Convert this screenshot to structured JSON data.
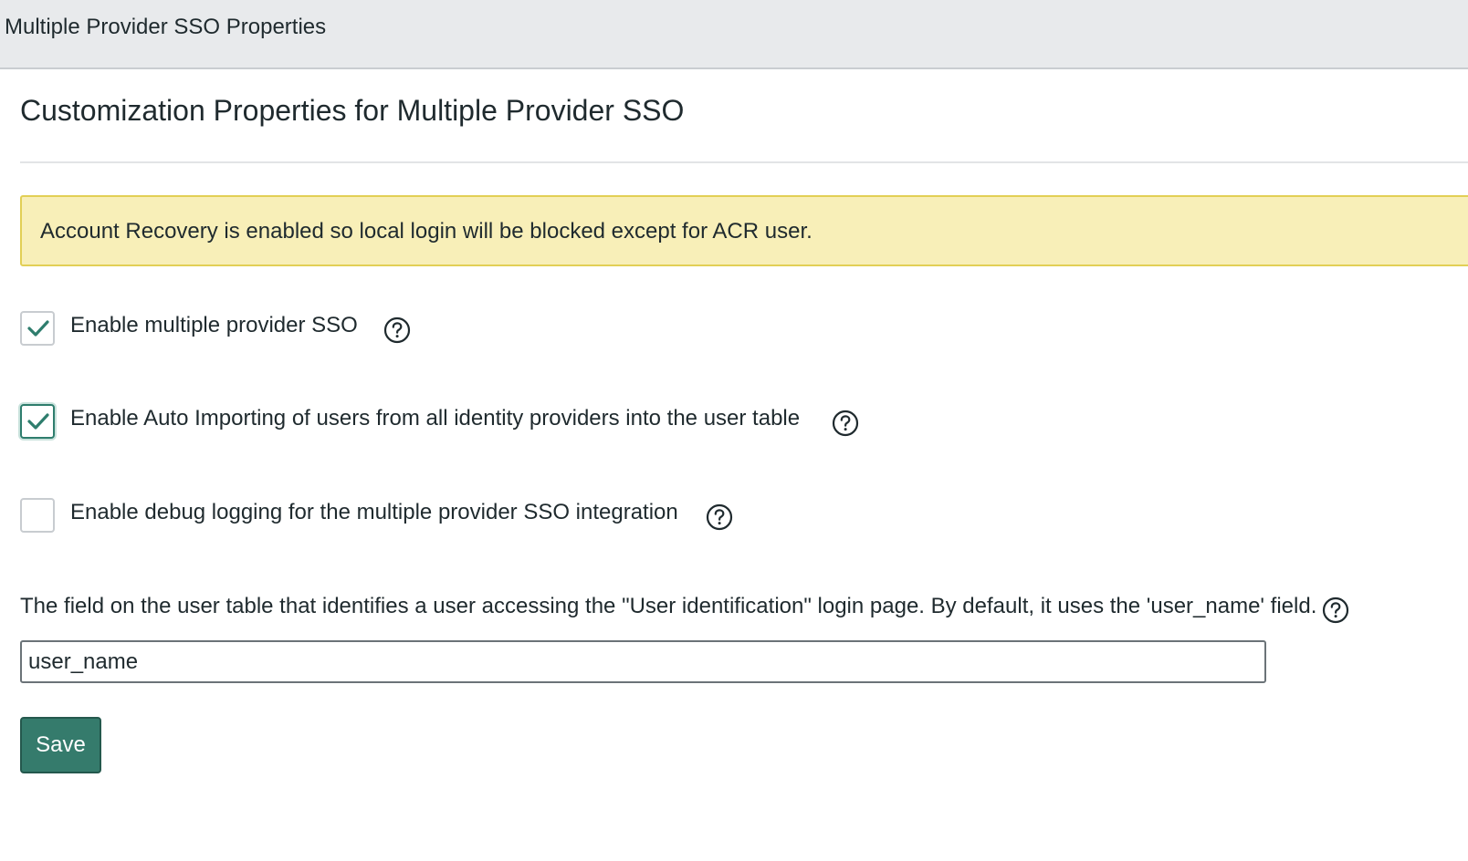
{
  "header": {
    "title": "Multiple Provider SSO Properties"
  },
  "page": {
    "title": "Customization Properties for Multiple Provider SSO"
  },
  "alert": {
    "message": "Account Recovery is enabled so local login will be blocked except for ACR user."
  },
  "options": [
    {
      "label": "Enable multiple provider SSO",
      "checked": true
    },
    {
      "label": "Enable Auto Importing of users from all identity providers into the user table",
      "checked": true,
      "focused": true
    },
    {
      "label": "Enable debug logging for the multiple provider SSO integration",
      "checked": false
    }
  ],
  "user_field": {
    "description": "The field on the user table that identifies a user accessing the \"User identification\" login page. By default, it uses the 'user_name' field.",
    "value": "user_name"
  },
  "actions": {
    "save_label": "Save"
  },
  "colors": {
    "accent": "#357b6c",
    "checkmark": "#2e7d6d",
    "alert_bg": "#f8efb8",
    "alert_border": "#e2cf55",
    "header_bg": "#e8eaec"
  },
  "icons": {
    "help": "question-circle-icon",
    "check": "check-icon"
  }
}
